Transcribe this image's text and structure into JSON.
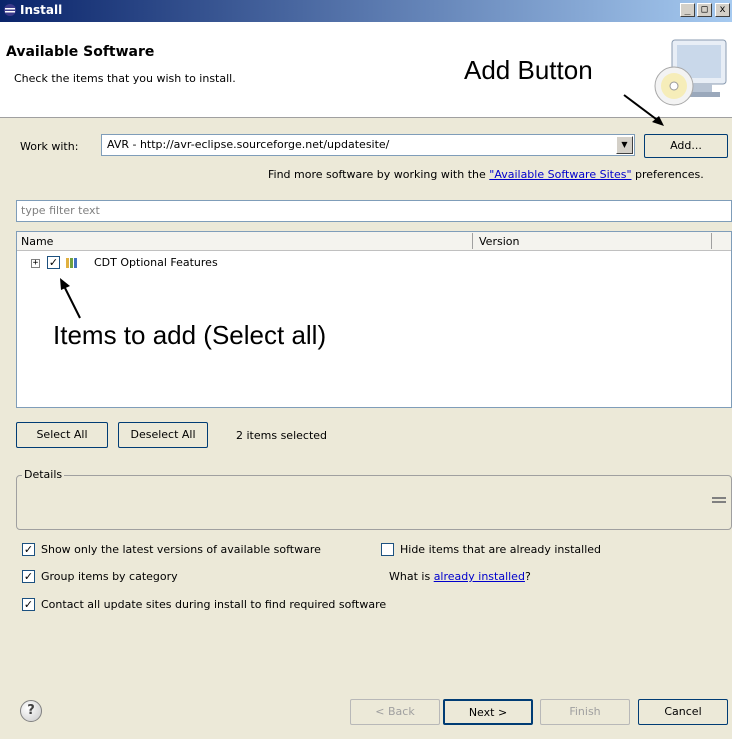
{
  "window": {
    "title": "Install",
    "minimize": "_",
    "maximize": "□",
    "close": "x"
  },
  "header": {
    "title": "Available Software",
    "subtitle": "Check the items that you wish to install.",
    "annotation": "Add Button"
  },
  "work_with": {
    "label": "Work with:",
    "value": "AVR - http://avr-eclipse.sourceforge.net/updatesite/",
    "add_button": "Add...",
    "find_more_prefix": "Find more software by working with the ",
    "find_more_link": "\"Available Software Sites\"",
    "find_more_suffix": " preferences."
  },
  "filter": {
    "placeholder": "type filter text"
  },
  "table": {
    "columns": [
      "Name",
      "Version"
    ],
    "rows": [
      {
        "label": "CDT Optional Features",
        "checked": true,
        "expander": "+"
      }
    ],
    "annotation": "Items to add (Select all)"
  },
  "selection": {
    "select_all": "Select All",
    "deselect_all": "Deselect All",
    "status": "2 items selected"
  },
  "details": {
    "label": "Details"
  },
  "options": {
    "latest_only": {
      "label": "Show only the latest versions of available software",
      "checked": true
    },
    "hide_installed": {
      "label": "Hide items that are already installed",
      "checked": false
    },
    "group_by_category": {
      "label": "Group items by category",
      "checked": true
    },
    "what_is_prefix": "What is ",
    "what_is_link": "already installed",
    "what_is_suffix": "?",
    "contact_sites": {
      "label": "Contact all update sites during install to find required software",
      "checked": true
    }
  },
  "buttons": {
    "help": "?",
    "back": "< Back",
    "next": "Next >",
    "finish": "Finish",
    "cancel": "Cancel"
  }
}
